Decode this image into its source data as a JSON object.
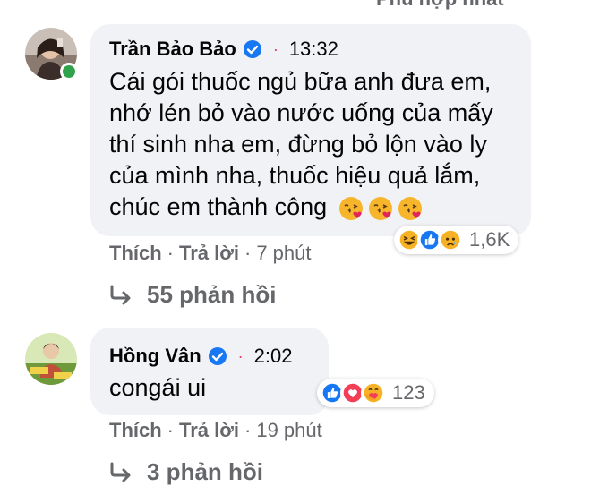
{
  "sort": {
    "label": "Phù hợp nhất"
  },
  "comments": [
    {
      "author": "Trần Bảo Bảo",
      "time": "13:32",
      "lines": [
        "Cái gói thuốc ngủ bữa anh đưa em,",
        "nhớ lén bỏ vào nước uống của mấy",
        "thí sinh nha em, đừng bỏ lộn vào ly",
        "của mình nha, thuốc hiệu quả lắm,",
        "chúc em thành công"
      ],
      "trailing_emojis": [
        "kissing-heart-emoji",
        "kissing-heart-emoji",
        "kissing-heart-emoji"
      ],
      "reactions": {
        "icons": [
          "haha-icon",
          "like-icon",
          "sad-icon"
        ],
        "count": "1,6K"
      },
      "actions": {
        "like": "Thích",
        "reply": "Trả lời",
        "age": "7 phút"
      },
      "replies": "55 phản hồi"
    },
    {
      "author": "Hồng Vân",
      "time": "2:02",
      "lines": [
        "congái ui"
      ],
      "reactions": {
        "icons": [
          "like-icon",
          "love-icon",
          "care-icon"
        ],
        "count": "123"
      },
      "actions": {
        "like": "Thích",
        "reply": "Trả lời",
        "age": "19 phút"
      },
      "replies": "3 phản hồi"
    }
  ],
  "colors": {
    "verified": "#1877f2",
    "like": "#1877f2",
    "love": "#f33e58",
    "online": "#31a24c"
  }
}
